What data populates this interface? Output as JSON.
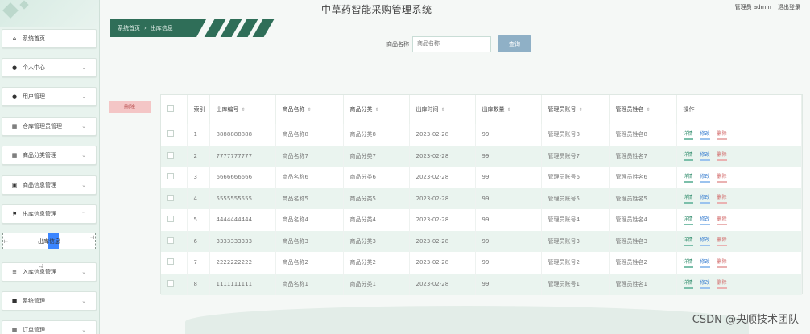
{
  "app_title": "中草药智能采购管理系统",
  "user": {
    "label": "管理员 admin",
    "logout": "退出登录"
  },
  "breadcrumb": {
    "home": "系统首页",
    "separator": "›",
    "current": "出库信息"
  },
  "search": {
    "label": "商品名称",
    "placeholder": "商品名称",
    "button": "查询"
  },
  "delete_button": "删除",
  "sidebar": {
    "items": [
      {
        "label": "系统首页",
        "icon": "home-icon",
        "glyph": "⌂"
      },
      {
        "label": "个人中心",
        "icon": "user-icon",
        "glyph": "●"
      },
      {
        "label": "用户管理",
        "icon": "user-icon",
        "glyph": "●"
      },
      {
        "label": "仓库管理员管理",
        "icon": "grid-icon",
        "glyph": "▦"
      },
      {
        "label": "商品分类管理",
        "icon": "grid-icon",
        "glyph": "▦"
      },
      {
        "label": "商品信息管理",
        "icon": "doc-icon",
        "glyph": "▣"
      },
      {
        "label": "出库信息管理",
        "icon": "flag-icon",
        "glyph": "⚑"
      },
      {
        "label": "入库信息管理",
        "icon": "list-icon",
        "glyph": "≡"
      },
      {
        "label": "系统管理",
        "icon": "lock-icon",
        "glyph": "■"
      },
      {
        "label": "订单管理",
        "icon": "grid-icon",
        "glyph": "▦"
      }
    ],
    "submenu": {
      "label": "出库信息"
    }
  },
  "table": {
    "headers": [
      "索引",
      "出库编号",
      "商品名称",
      "商品分类",
      "出库时间",
      "出库数量",
      "管理员账号",
      "管理员姓名",
      "操作"
    ],
    "actions": {
      "detail": "详情",
      "edit": "修改",
      "delete": "删除"
    },
    "rows": [
      {
        "idx": "1",
        "code": "8888888888",
        "name": "商品名称8",
        "cat": "商品分类8",
        "time": "2023-02-28",
        "qty": "99",
        "acct": "管理员账号8",
        "admin": "管理员姓名8"
      },
      {
        "idx": "2",
        "code": "7777777777",
        "name": "商品名称7",
        "cat": "商品分类7",
        "time": "2023-02-28",
        "qty": "99",
        "acct": "管理员账号7",
        "admin": "管理员姓名7"
      },
      {
        "idx": "3",
        "code": "6666666666",
        "name": "商品名称6",
        "cat": "商品分类6",
        "time": "2023-02-28",
        "qty": "99",
        "acct": "管理员账号6",
        "admin": "管理员姓名6"
      },
      {
        "idx": "4",
        "code": "5555555555",
        "name": "商品名称5",
        "cat": "商品分类5",
        "time": "2023-02-28",
        "qty": "99",
        "acct": "管理员账号5",
        "admin": "管理员姓名5"
      },
      {
        "idx": "5",
        "code": "4444444444",
        "name": "商品名称4",
        "cat": "商品分类4",
        "time": "2023-02-28",
        "qty": "99",
        "acct": "管理员账号4",
        "admin": "管理员姓名4"
      },
      {
        "idx": "6",
        "code": "3333333333",
        "name": "商品名称3",
        "cat": "商品分类3",
        "time": "2023-02-28",
        "qty": "99",
        "acct": "管理员账号3",
        "admin": "管理员姓名3"
      },
      {
        "idx": "7",
        "code": "2222222222",
        "name": "商品名称2",
        "cat": "商品分类2",
        "time": "2023-02-28",
        "qty": "99",
        "acct": "管理员账号2",
        "admin": "管理员姓名2"
      },
      {
        "idx": "8",
        "code": "1111111111",
        "name": "商品名称1",
        "cat": "商品分类1",
        "time": "2023-02-28",
        "qty": "99",
        "acct": "管理员账号1",
        "admin": "管理员姓名1"
      }
    ]
  },
  "watermark": "CSDN @央顺技术团队",
  "colors": {
    "accent": "#2f6e58",
    "sidebar_bg": "#e8f3ee",
    "search_btn": "#8fb0c6",
    "delete_btn": "#f4c6c6"
  }
}
